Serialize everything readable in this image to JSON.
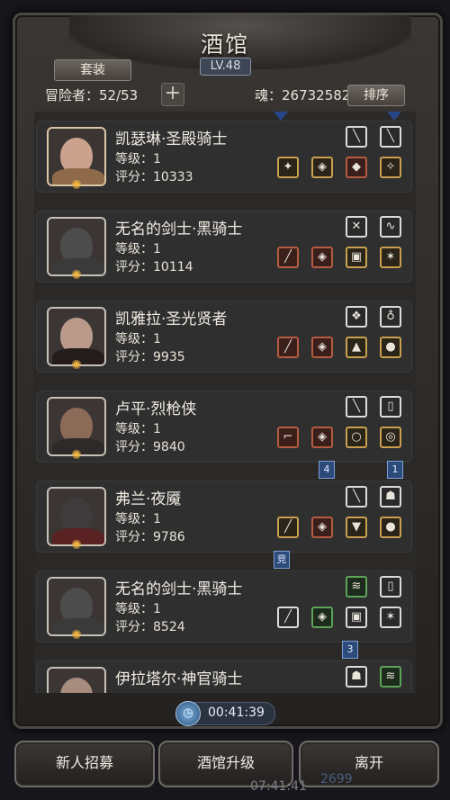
{
  "header": {
    "title": "酒馆",
    "level": "LV.48",
    "suit_label": "套装",
    "adventurer_label": "冒险者：52/53",
    "soul_label": "魂：26732582",
    "sort_label": "排序",
    "add_label": "+"
  },
  "heroes": [
    {
      "name": "凯瑟琳·圣殿骑士",
      "level": "等级：1",
      "score": "评分：10333"
    },
    {
      "name": "无名的剑士·黑骑士",
      "level": "等级：1",
      "score": "评分：10114"
    },
    {
      "name": "凯雅拉·圣光贤者",
      "level": "等级：1",
      "score": "评分：9935"
    },
    {
      "name": "卢平·烈枪侠",
      "level": "等级：1",
      "score": "评分：9840"
    },
    {
      "name": "弗兰·夜魇",
      "level": "等级：1",
      "score": "评分：9786"
    },
    {
      "name": "无名的剑士·黑骑士",
      "level": "等级：1",
      "score": "评分：8524"
    },
    {
      "name": "伊拉塔尔·神官骑士",
      "level": "",
      "score": ""
    }
  ],
  "tags": {
    "t1": "4",
    "t2": "1",
    "t3": "竞",
    "t4": "3"
  },
  "timer": {
    "time": "00:41:39"
  },
  "buttons": {
    "recruit": "新人招募",
    "upgrade": "酒馆升级",
    "leave": "离开"
  },
  "status": {
    "clock": "07:41:41",
    "coin": "2699"
  },
  "colors": {
    "tag_blue": "#2c4a7a",
    "gold": "#f0b540"
  }
}
